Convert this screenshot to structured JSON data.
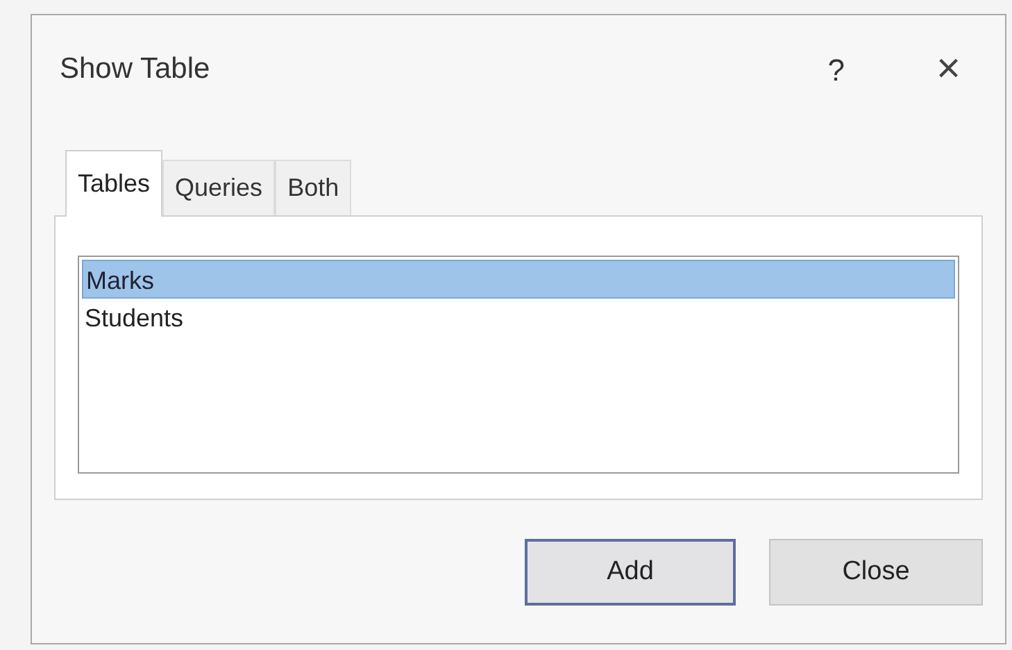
{
  "window": {
    "title": "Show Table",
    "help": "?",
    "close": "×"
  },
  "tabs": [
    {
      "label": "Tables",
      "selected": true
    },
    {
      "label": "Queries",
      "selected": false
    },
    {
      "label": "Both",
      "selected": false
    }
  ],
  "list": [
    {
      "label": "Marks",
      "selected": true
    },
    {
      "label": "Students",
      "selected": false
    }
  ],
  "buttons": [
    {
      "label": "Add",
      "kind": "default"
    },
    {
      "label": "Close",
      "kind": "normal"
    }
  ]
}
